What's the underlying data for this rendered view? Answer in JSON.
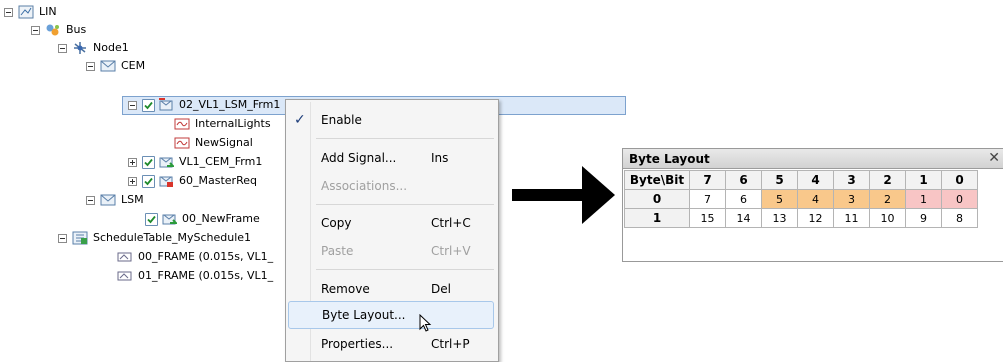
{
  "tree": {
    "root": "LIN",
    "bus": "Bus",
    "node": "Node1",
    "cem": "CEM",
    "frame_selected": "02_VL1_LSM_Frm1",
    "signal_1": "InternalLights",
    "signal_2": "NewSignal",
    "frame_2": "VL1_CEM_Frm1",
    "frame_3": "60_MasterReq",
    "lsm": "LSM",
    "frame_4": "00_NewFrame",
    "schedule": "ScheduleTable_MySchedule1",
    "slot_1": "00_FRAME (0.015s, VL1_",
    "slot_2": "01_FRAME (0.015s, VL1_"
  },
  "menu": {
    "items": [
      {
        "label": "Enable",
        "shortcut": "",
        "checked": true,
        "disabled": false
      },
      {
        "label": "Add Signal...",
        "shortcut": "Ins",
        "disabled": false
      },
      {
        "label": "Associations...",
        "shortcut": "",
        "disabled": true
      },
      {
        "label": "Copy",
        "shortcut": "Ctrl+C",
        "disabled": false
      },
      {
        "label": "Paste",
        "shortcut": "Ctrl+V",
        "disabled": true
      },
      {
        "label": "Remove",
        "shortcut": "Del",
        "disabled": false
      },
      {
        "label": "Byte Layout...",
        "shortcut": "",
        "disabled": false,
        "hover": true
      },
      {
        "label": "Properties...",
        "shortcut": "Ctrl+P",
        "disabled": false
      }
    ]
  },
  "byte_layout": {
    "title": "Byte Layout",
    "close": "✕",
    "header": [
      "Byte\\Bit",
      "7",
      "6",
      "5",
      "4",
      "3",
      "2",
      "1",
      "0"
    ],
    "rows": [
      {
        "byte": "0",
        "cells": [
          "7",
          "6",
          "5",
          "4",
          "3",
          "2",
          "1",
          "0"
        ]
      },
      {
        "byte": "1",
        "cells": [
          "15",
          "14",
          "13",
          "12",
          "11",
          "10",
          "9",
          "8"
        ]
      }
    ],
    "colors": {
      "orange": "#f9c88b",
      "pink": "#f8c5c5"
    }
  }
}
